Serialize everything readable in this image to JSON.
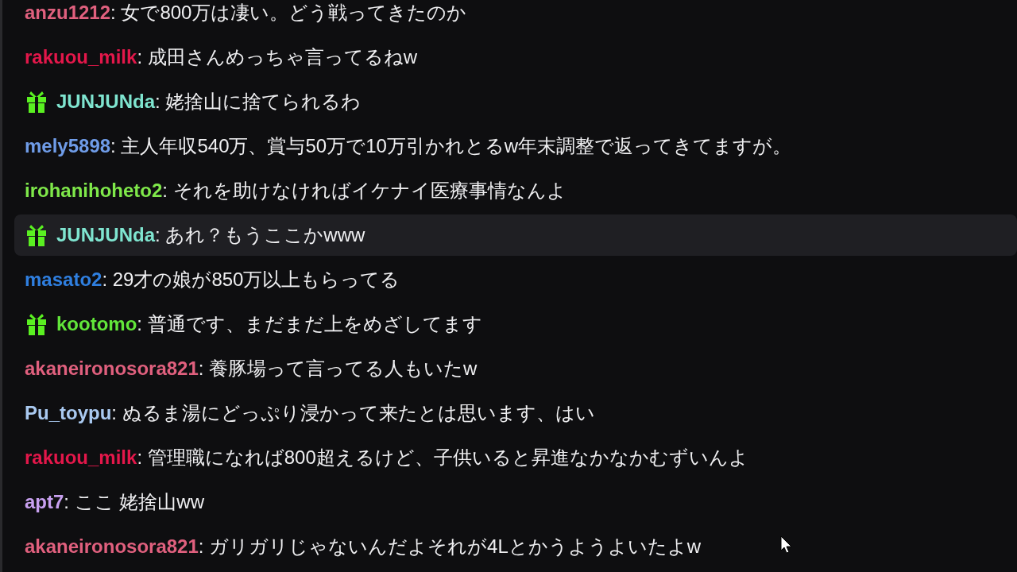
{
  "messages": [
    {
      "user": "anzu1212",
      "color": "#e0607e",
      "text": ": 女で800万は凄い。どう戦ってきたのか",
      "gift_badge": false,
      "highlighted": false
    },
    {
      "user": "rakuou_milk",
      "color": "#e3174a",
      "text": ": 成田さんめっちゃ言ってるねw",
      "gift_badge": false,
      "highlighted": false
    },
    {
      "user": "JUNJUNda",
      "color": "#7fe5d0",
      "text": ": 姥捨山に捨てられるわ",
      "gift_badge": true,
      "highlighted": false
    },
    {
      "user": "mely5898",
      "color": "#6f9ce8",
      "text": ": 主人年収540万、賞与50万で10万引かれとるw年末調整で返ってきてますが。",
      "gift_badge": false,
      "highlighted": false
    },
    {
      "user": "irohanihoheto2",
      "color": "#7fe84a",
      "text": ": それを助けなければイケナイ医療事情なんよ",
      "gift_badge": false,
      "highlighted": false
    },
    {
      "user": "JUNJUNda",
      "color": "#7fe5d0",
      "text": ": あれ？もうここかwww",
      "gift_badge": true,
      "highlighted": true
    },
    {
      "user": "masato2",
      "color": "#2f7fe0",
      "text": ": 29才の娘が850万以上もらってる",
      "gift_badge": false,
      "highlighted": false
    },
    {
      "user": "kootomo",
      "color": "#62e63a",
      "text": ": 普通です、まだまだ上をめざしてます",
      "gift_badge": true,
      "highlighted": false
    },
    {
      "user": "akaneironosora821",
      "color": "#e0607e",
      "text": ": 養豚場って言ってる人もいたw",
      "gift_badge": false,
      "highlighted": false
    },
    {
      "user": "Pu_toypu",
      "color": "#a9c9f0",
      "text": ": ぬるま湯にどっぷり浸かって来たとは思います、はい",
      "gift_badge": false,
      "highlighted": false
    },
    {
      "user": "rakuou_milk",
      "color": "#e3174a",
      "text": ": 管理職になれば800超えるけど、子供いると昇進なかなかむずいんよ",
      "gift_badge": false,
      "highlighted": false
    },
    {
      "user": "apt7",
      "color": "#c8a0f0",
      "text": ": ここ 姥捨山ww",
      "gift_badge": false,
      "highlighted": false
    },
    {
      "user": "akaneironosora821",
      "color": "#e0607e",
      "text": ": ガリガリじゃないんだよそれが4Lとかうようよいたよw",
      "gift_badge": false,
      "highlighted": false
    }
  ]
}
